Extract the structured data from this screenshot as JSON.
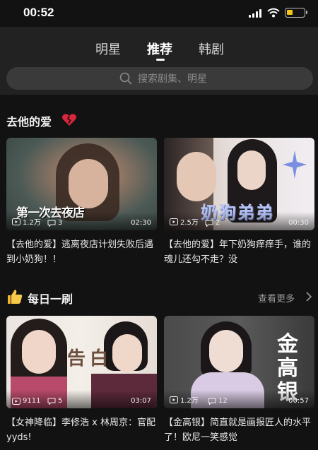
{
  "status": {
    "time": "00:52"
  },
  "tabs": [
    {
      "label": "明星",
      "active": false
    },
    {
      "label": "推荐",
      "active": true
    },
    {
      "label": "韩剧",
      "active": false
    }
  ],
  "search": {
    "placeholder": "搜索剧集、明星",
    "icon": "search-icon"
  },
  "sections": [
    {
      "title": "去他的爱",
      "icon": "broken-heart-icon",
      "cards": [
        {
          "views": "1.2万",
          "comments": "3",
          "duration": "02:30",
          "overlay": "第一次去夜店",
          "title": "【去他的爱】逃离夜店计划失败后遇到小奶狗！！"
        },
        {
          "views": "2.5万",
          "comments": "2",
          "duration": "00:30",
          "overlay": "奶狗弟弟",
          "title": "【去他的爱】年下奶狗痒痒手，谁的魂儿还勾不走？没"
        }
      ]
    },
    {
      "title": "每日一刷",
      "icon": "thumbs-up-icon",
      "more": "查看更多",
      "cards": [
        {
          "views": "9111",
          "comments": "5",
          "duration": "03:07",
          "overlay": "告白",
          "title": "【女神降临】李修浩 x 林周京：官配 yyds!"
        },
        {
          "views": "1.2万",
          "comments": "12",
          "duration": "00:57",
          "overlay": "金高银",
          "title": "【金高银】简直就是画报匠人的水平了！欧尼一笑感觉"
        }
      ]
    }
  ],
  "colors": {
    "background": "#121212",
    "header": "#222222",
    "accent_yellow": "#f5c518"
  }
}
